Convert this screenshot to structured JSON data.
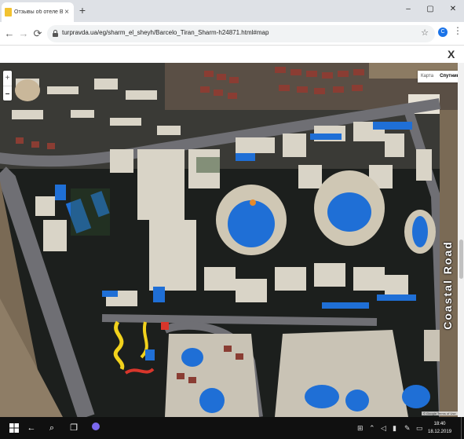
{
  "browser": {
    "tab_title": "Отзывы об отеле Barcelo Tiran",
    "new_tab": "+",
    "url": "turpravda.ua/eg/sharm_el_sheyh/Barcelo_Tiran_Sharm-h24871.html#map",
    "profile_initial": "C",
    "controls": {
      "minimize": "–",
      "maximize": "▢",
      "close": "✕"
    }
  },
  "overlay": {
    "close": "X"
  },
  "map": {
    "zoom_in": "+",
    "zoom_out": "–",
    "map_type_options": [
      "Карта",
      "Спутник"
    ],
    "selected_map_type": "Спутник",
    "road_label": "Coastal Road",
    "attribution": "© Google  Terms of Use",
    "colors": {
      "pool": "#1f6fd6",
      "road": "#6f6f74",
      "ground": "#1c1f1d",
      "building": "#d9d4c7",
      "roof": "#8a3d33",
      "sand": "#8c7b63"
    }
  },
  "taskbar": {
    "time": "18:40",
    "date": "18.12.2019",
    "icons": [
      "windows-icon",
      "back-icon",
      "search-icon",
      "task-view-icon",
      "cortana-icon"
    ]
  }
}
